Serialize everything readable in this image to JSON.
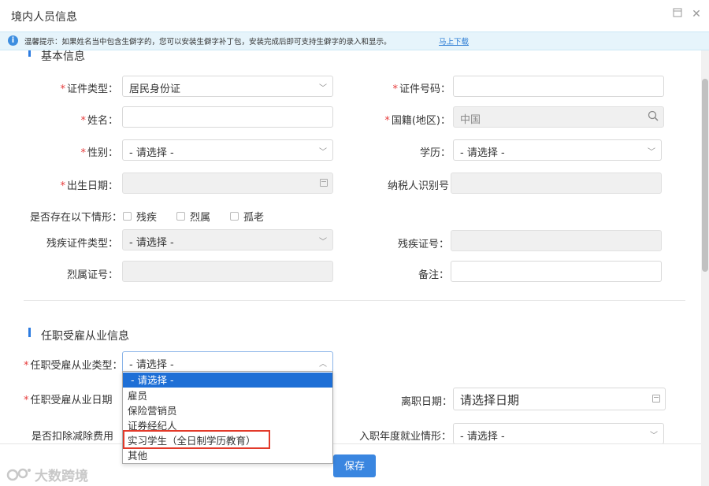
{
  "window": {
    "title": "境内人员信息"
  },
  "notice": {
    "message": "温馨提示：如果姓名当中包含生僻字的，您可以安装生僻字补丁包，安装完成后即可支持生僻字的录入和显示。",
    "link": "马上下载"
  },
  "basic": {
    "section_title": "基本信息",
    "id_type": {
      "label": "证件类型",
      "value": "居民身份证"
    },
    "id_number": {
      "label": "证件号码",
      "value": ""
    },
    "name": {
      "label": "姓名",
      "value": ""
    },
    "nationality": {
      "label": "国籍(地区)",
      "value": "中国"
    },
    "gender": {
      "label": "性别",
      "value": "- 请选择 -"
    },
    "education": {
      "label": "学历",
      "value": "- 请选择 -"
    },
    "birth_date": {
      "label": "出生日期",
      "value": ""
    },
    "taxpayer_id": {
      "label": "纳税人识别号",
      "value": ""
    },
    "situations": {
      "label": "是否存在以下情形",
      "options": [
        "残疾",
        "烈属",
        "孤老"
      ]
    },
    "disability_cert_type": {
      "label": "残疾证件类型",
      "value": "- 请选择 -"
    },
    "disability_cert_no": {
      "label": "残疾证号",
      "value": ""
    },
    "martyr_cert_no": {
      "label": "烈属证号",
      "value": ""
    },
    "remark": {
      "label": "备注",
      "value": ""
    }
  },
  "employment": {
    "section_title": "任职受雇从业信息",
    "type": {
      "label": "任职受雇从业类型",
      "value": "- 请选择 -"
    },
    "date": {
      "label": "任职受雇从业日期"
    },
    "leave_date": {
      "label": "离职日期",
      "placeholder": "请选择日期"
    },
    "deduct": {
      "label": "是否扣除减除费用"
    },
    "entry_year": {
      "label": "入职年度就业情形",
      "value": "- 请选择 -"
    },
    "options": [
      "- 请选择 -",
      "雇员",
      "保险营销员",
      "证券经纪人",
      "实习学生（全日制学历教育）",
      "其他"
    ],
    "selected_index": 0,
    "highlighted_index": 4
  },
  "actions": {
    "save": "保存"
  },
  "watermark": {
    "text": "大数跨境"
  },
  "colors": {
    "accent": "#3a86e0",
    "required": "#e63c3c",
    "highlight": "#e23a2a",
    "notice_bg": "#e6f4fb"
  }
}
